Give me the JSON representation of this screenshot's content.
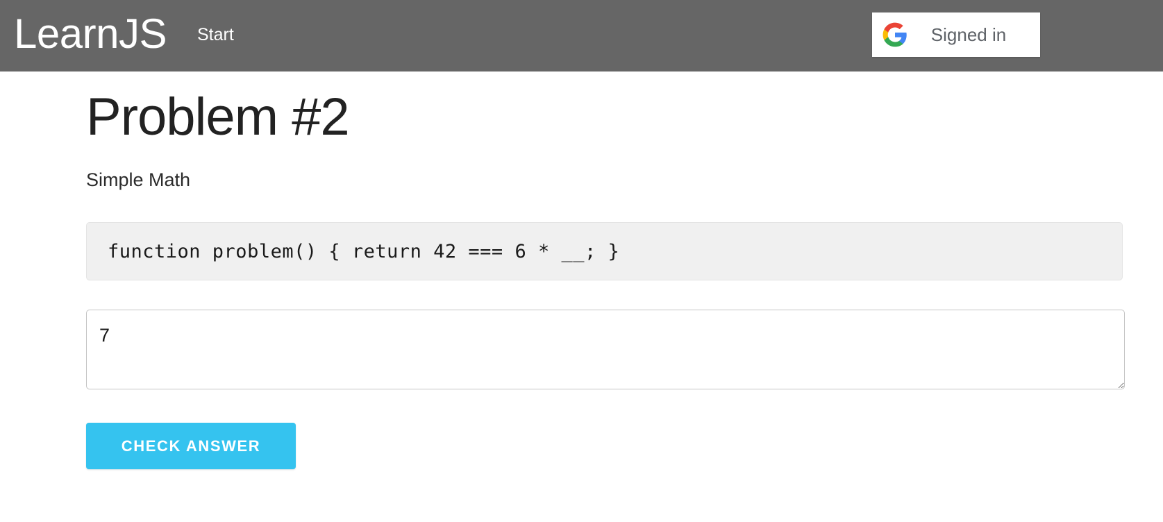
{
  "header": {
    "brand": "LearnJS",
    "nav": [
      {
        "label": "Start",
        "name": "nav-link-start"
      }
    ],
    "auth_button": {
      "label": "Signed in",
      "icon": "google-g-icon"
    },
    "background_color": "#666666",
    "text_color": "#ffffff"
  },
  "main": {
    "title": "Problem #2",
    "description": "Simple Math",
    "code": "function problem() { return 42 === 6 * __; }",
    "answer": {
      "value": "7",
      "placeholder": ""
    },
    "submit_label": "Check Answer",
    "accent_color": "#35c3ef",
    "code_background": "#f0f0f0"
  }
}
